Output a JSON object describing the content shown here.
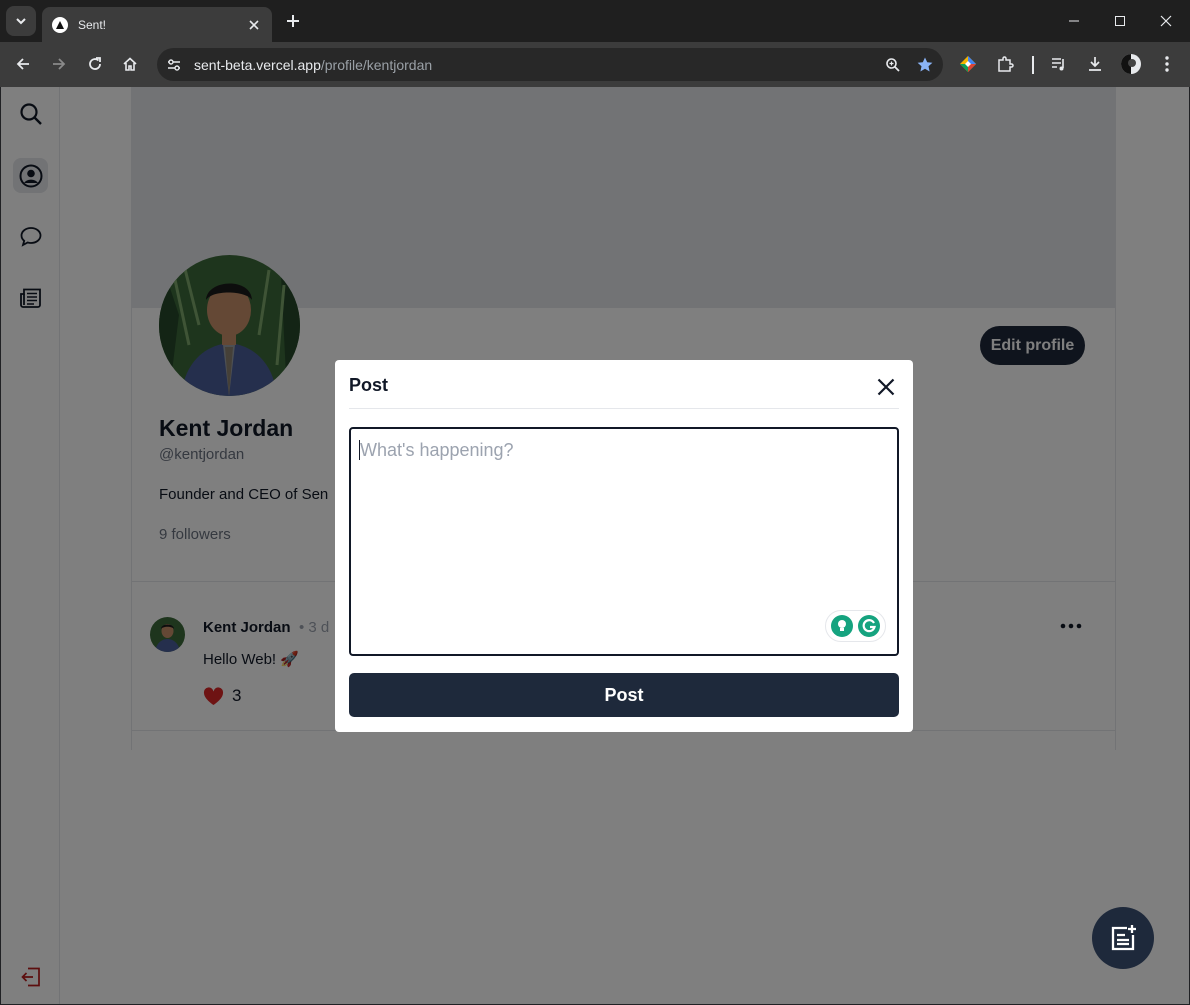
{
  "browser": {
    "tab_title": "Sent!",
    "url_host": "sent-beta.vercel.app",
    "url_path": "/profile/kentjordan"
  },
  "nav": {
    "items": [
      {
        "icon": "search-icon",
        "active": false
      },
      {
        "icon": "profile-icon",
        "active": true
      },
      {
        "icon": "chat-bubble-icon",
        "active": false
      },
      {
        "icon": "newspaper-icon",
        "active": false
      }
    ],
    "logout_icon": "logout-icon",
    "logout_color": "#b91c1c"
  },
  "profile": {
    "name": "Kent Jordan",
    "handle": "@kentjordan",
    "bio": "Founder and CEO of Sen",
    "followers": "9 followers",
    "edit_button": "Edit profile"
  },
  "post": {
    "author": "Kent Jordan",
    "meta": "• 3 d",
    "text": "Hello Web! 🚀",
    "likes": "3",
    "like_color": "#dc2626"
  },
  "modal": {
    "title": "Post",
    "placeholder": "What's happening?",
    "submit_label": "Post"
  },
  "colors": {
    "primary": "#1e293b",
    "grammarly": "#15a37f",
    "bookmark_star": "#8ab4f8"
  }
}
